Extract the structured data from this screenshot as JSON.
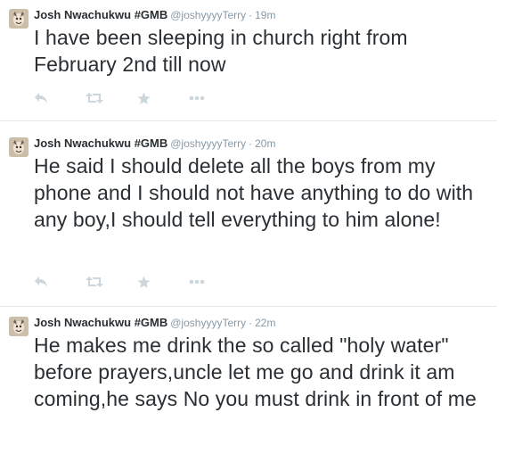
{
  "tweets": [
    {
      "name": "Josh Nwachukwu #GMB",
      "handle": "@joshyyyyTerry",
      "dot": "·",
      "time": "19m",
      "text": "I have been sleeping in church right from February 2nd till now"
    },
    {
      "name": "Josh Nwachukwu #GMB",
      "handle": "@joshyyyyTerry",
      "dot": "·",
      "time": "20m",
      "text": "He said I should delete all the boys from my phone and I should not have anything to do with any boy,I should tell everything to him alone!"
    },
    {
      "name": "Josh Nwachukwu #GMB",
      "handle": "@joshyyyyTerry",
      "dot": "·",
      "time": "22m",
      "text": "He makes me drink the so called \"holy water\" before prayers,uncle let me go and drink it am coming,he says No you must drink in front of me"
    }
  ],
  "icons": {
    "reply": "reply-icon",
    "retweet": "retweet-icon",
    "favorite": "star-icon",
    "more": "more-icon"
  },
  "colors": {
    "icon": "#ccd6dd",
    "muted": "#8899a6",
    "text": "#292f33",
    "divider": "#e1e8ed"
  }
}
